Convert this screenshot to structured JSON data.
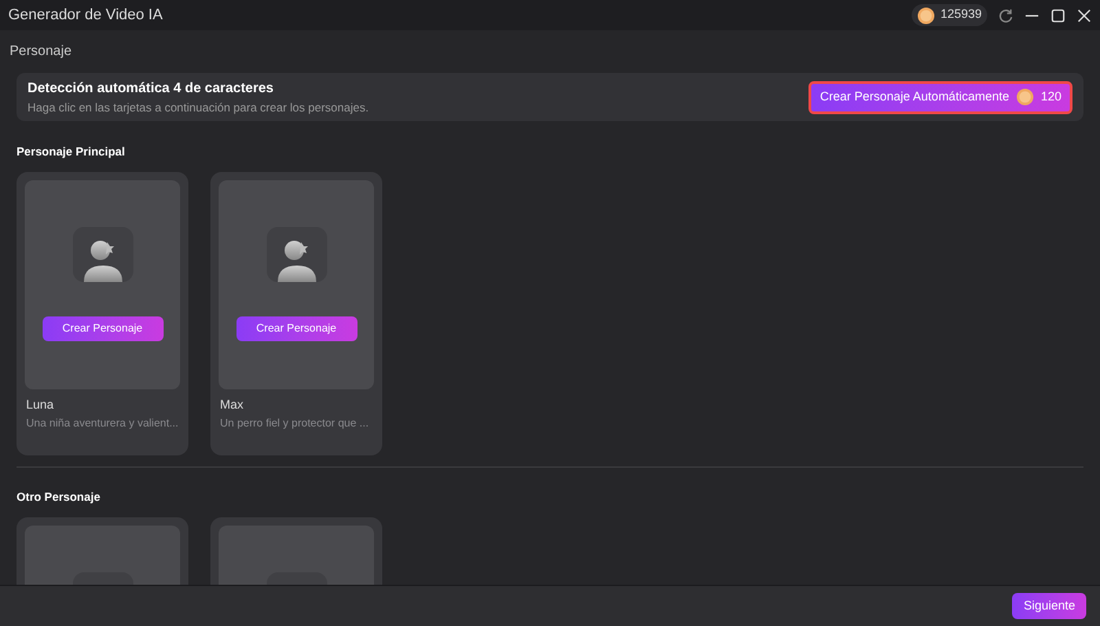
{
  "window": {
    "title": "Generador de Video IA",
    "credits": "125939"
  },
  "page_title": "Personaje",
  "banner": {
    "title": "Detección automática 4 de caracteres",
    "subtitle": "Haga clic en las tarjetas a continuación para crear los personajes.",
    "button": "Crear Personaje Automáticamente",
    "cost": "120"
  },
  "sections": [
    {
      "title": "Personaje Principal",
      "cards": [
        {
          "kind": "character",
          "button": "Crear Personaje",
          "name": "Luna",
          "description": "Una niña aventurera y valient..."
        },
        {
          "kind": "character",
          "button": "Crear Personaje",
          "name": "Max",
          "description": "Un perro fiel y protector que ..."
        }
      ]
    },
    {
      "title": "Otro Personaje",
      "cards": [
        {
          "kind": "character_hidden"
        },
        {
          "kind": "character_hidden"
        }
      ]
    }
  ],
  "footer": {
    "button": "Siguiente"
  }
}
